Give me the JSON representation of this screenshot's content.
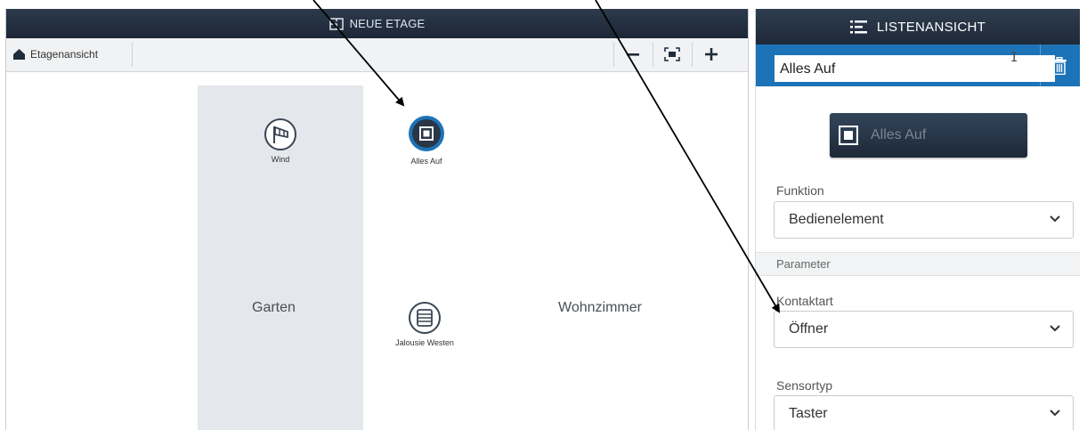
{
  "floor_panel": {
    "title": "NEUE ETAGE",
    "breadcrumb": "Etagenansicht",
    "zoom_out_label": "−",
    "zoom_in_label": "+"
  },
  "rooms": {
    "left": "Garten",
    "right": "Wohnzimmer"
  },
  "devices": [
    {
      "label": "Wind",
      "icon": "windsock-icon"
    },
    {
      "label": "Alles Auf",
      "icon": "square-button-icon",
      "selected": true
    },
    {
      "label": "Jalousie Westen",
      "icon": "blind-icon"
    }
  ],
  "list_panel": {
    "title": "LISTENANSICHT",
    "name_value": "Alles Auf",
    "preview_label": "Alles Auf",
    "function_label": "Funktion",
    "function_value": "Bedienelement",
    "section_label": "Parameter",
    "contact_label": "Kontaktart",
    "contact_value": "Öffner",
    "sensor_label": "Sensortyp",
    "sensor_value": "Taster"
  },
  "colors": {
    "header_dark": "#1e2939",
    "accent_blue": "#1d73b8",
    "room_fill": "#e4e7eb"
  }
}
